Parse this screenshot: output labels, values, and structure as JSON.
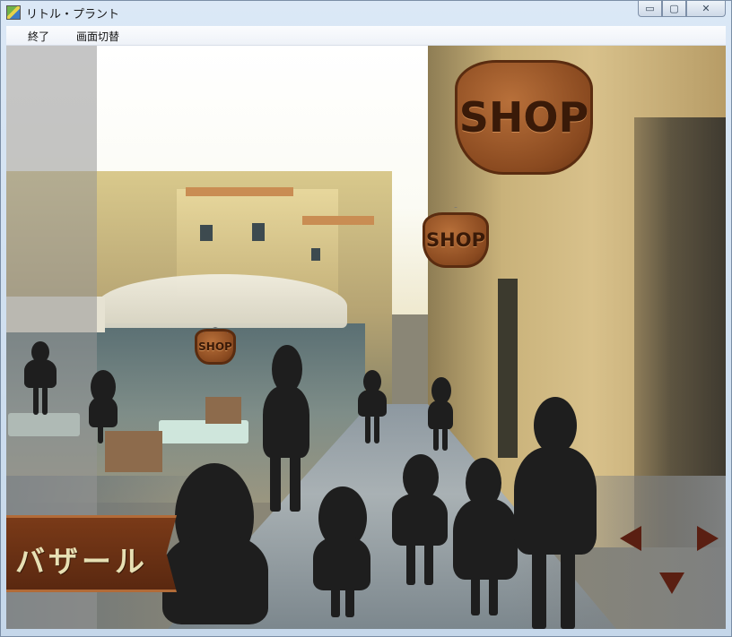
{
  "window": {
    "title": "リトル・プラント",
    "minimize_glyph": "▭",
    "maximize_glyph": "▢",
    "close_glyph": "✕"
  },
  "menu": {
    "items": [
      {
        "label": "終了"
      },
      {
        "label": "画面切替"
      }
    ]
  },
  "scene": {
    "signs": [
      {
        "label": "SHOP"
      },
      {
        "label": "SHOP"
      },
      {
        "label": "SHOP"
      }
    ],
    "location_banner": "バザール",
    "nav": {
      "left_icon": "triangle-left-icon",
      "right_icon": "triangle-right-icon",
      "down_icon": "triangle-down-icon"
    }
  },
  "colors": {
    "sign_wood": "#8a4a20",
    "silhouette": "#1e1e1e",
    "arrow": "#5a1f12",
    "banner": "#6a3014"
  }
}
